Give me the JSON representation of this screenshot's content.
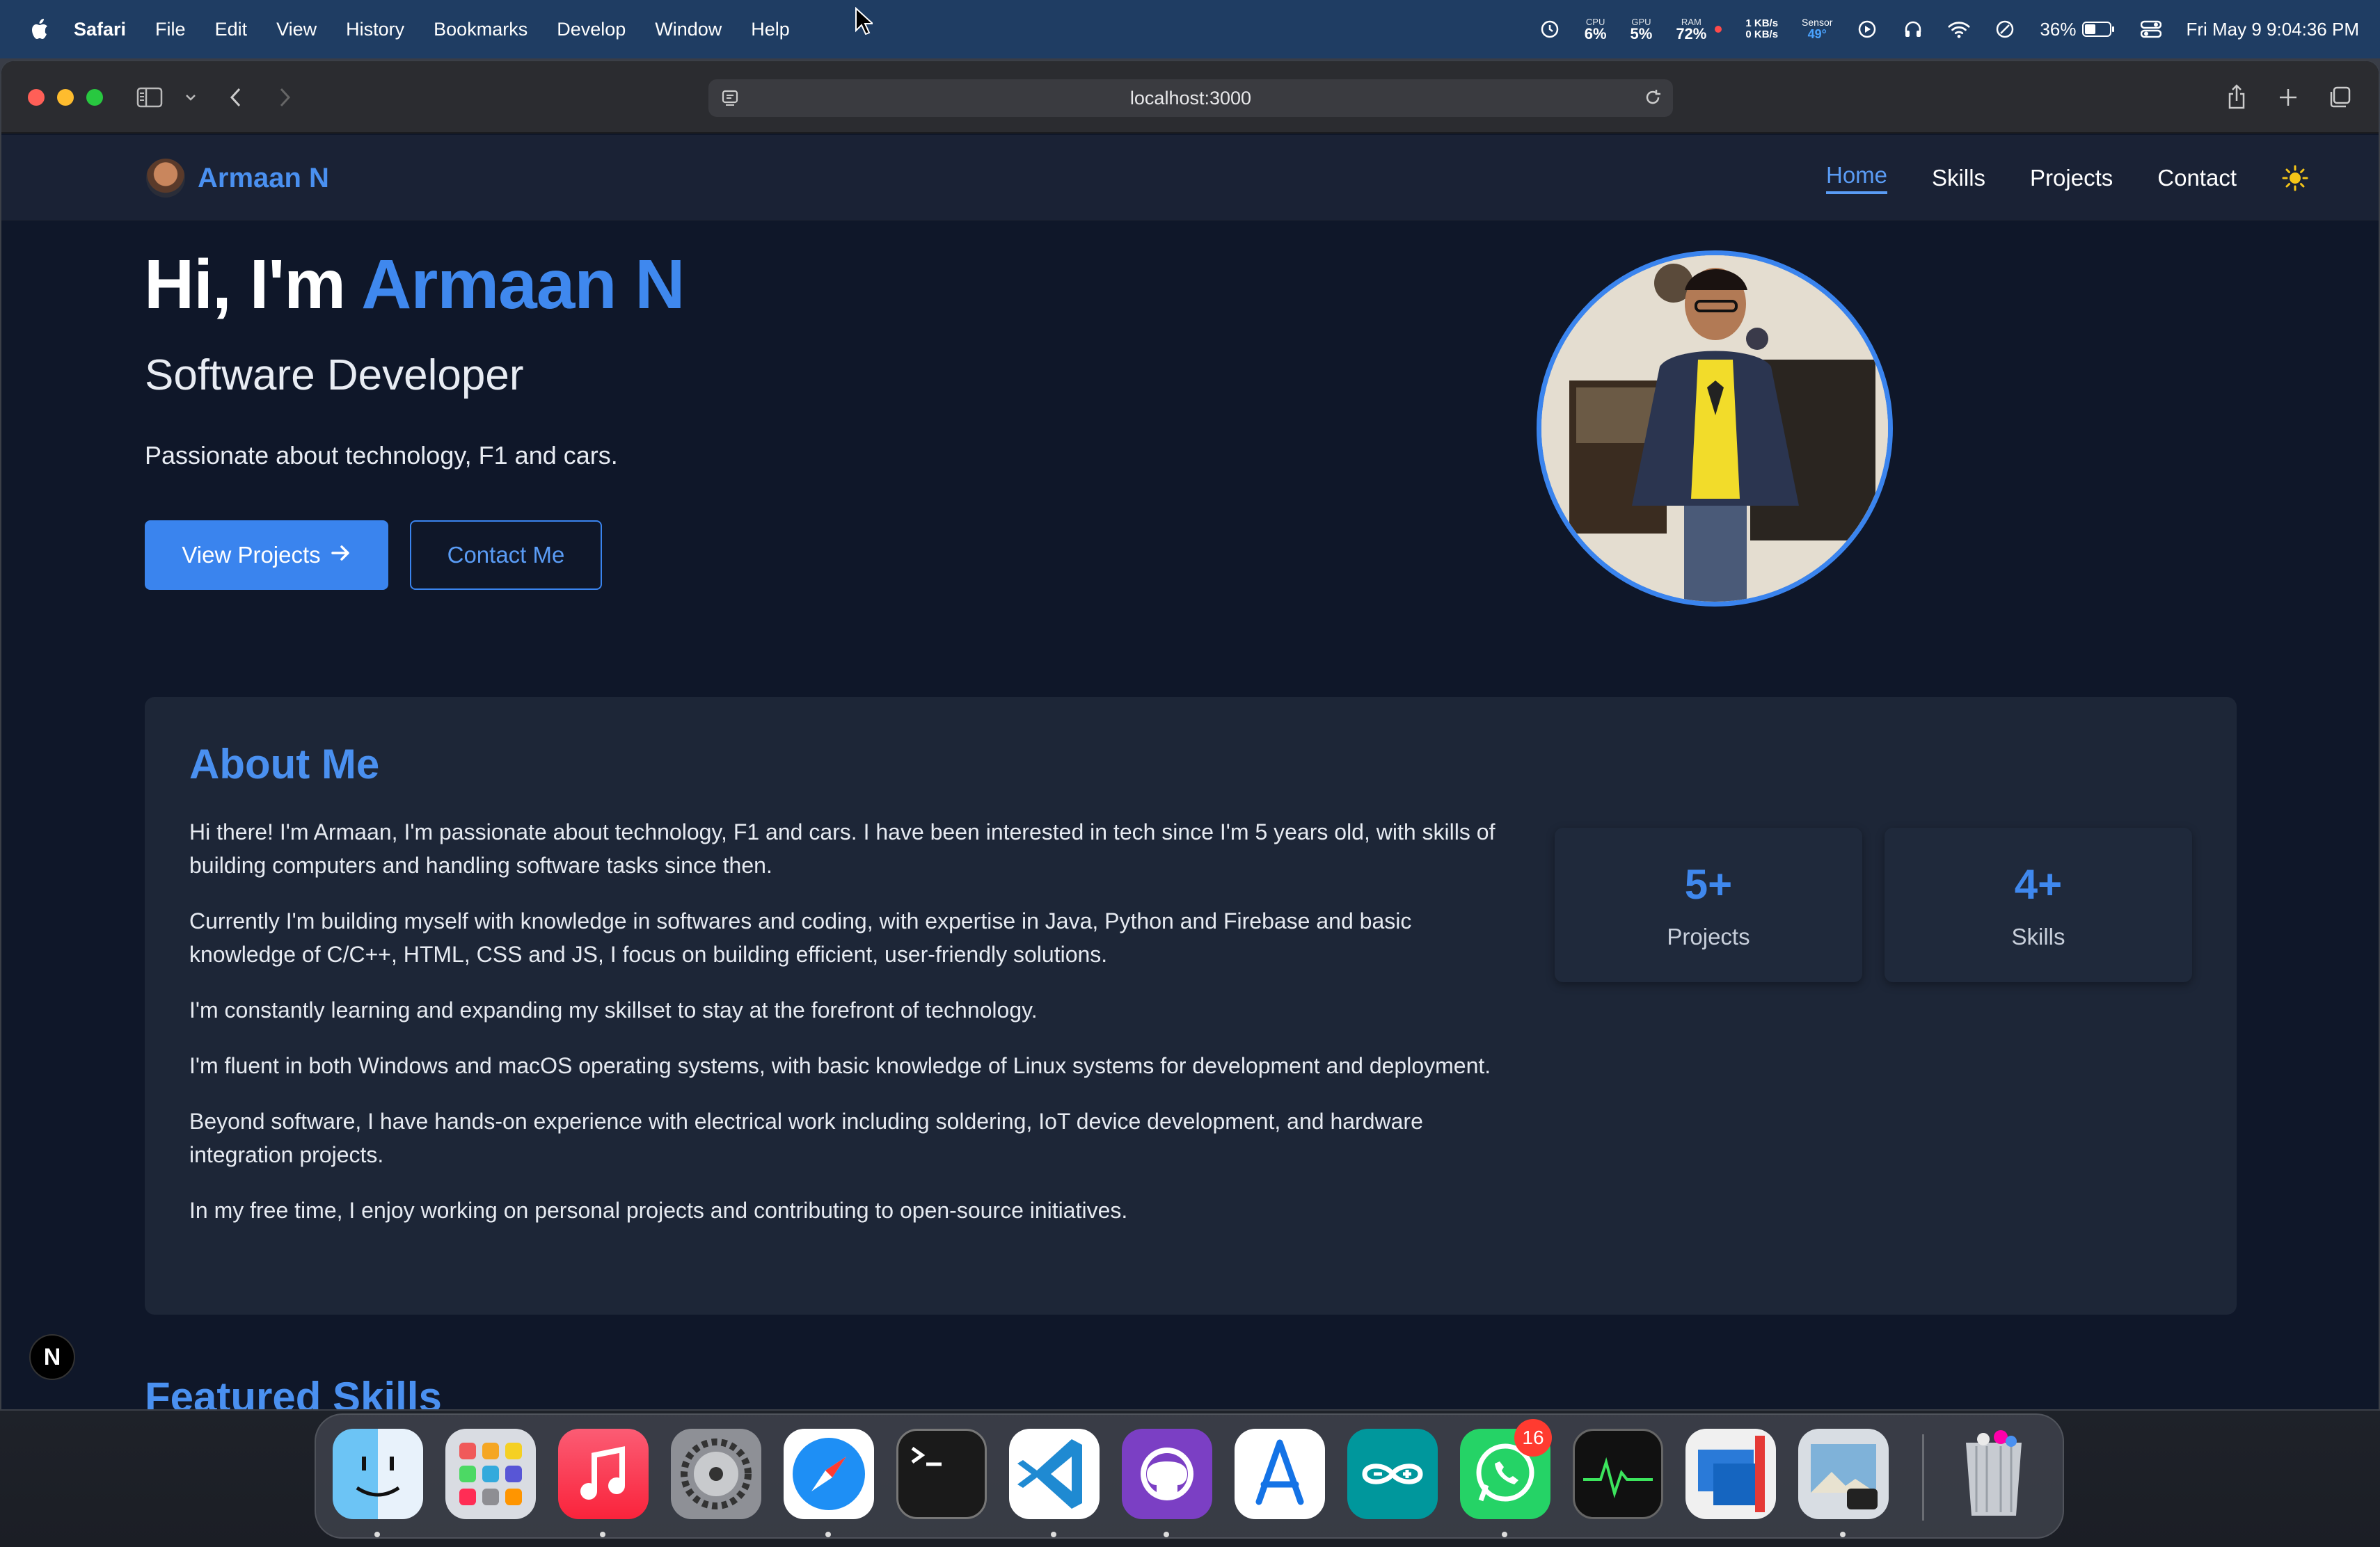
{
  "menubar": {
    "app": "Safari",
    "items": [
      "File",
      "Edit",
      "View",
      "History",
      "Bookmarks",
      "Develop",
      "Window",
      "Help"
    ],
    "cpu_label": "CPU",
    "cpu_value": "6%",
    "gpu_label": "GPU",
    "gpu_value": "5%",
    "ram_label": "RAM",
    "ram_value": "72%",
    "net_up": "1 KB/s",
    "net_down": "0 KB/s",
    "sensor_label": "Sensor",
    "sensor_value": "49°",
    "battery": "36%",
    "datetime": "Fri May 9  9:04:36 PM"
  },
  "browser": {
    "url": "localhost:3000"
  },
  "nav": {
    "brand": "Armaan N",
    "links": [
      "Home",
      "Skills",
      "Projects",
      "Contact"
    ],
    "active": "Home"
  },
  "hero": {
    "greeting": "Hi, I'm ",
    "name": "Armaan N",
    "subtitle": "Software Developer",
    "tagline": "Passionate about technology, F1 and cars.",
    "primary_button": "View Projects",
    "secondary_button": "Contact Me"
  },
  "about": {
    "title": "About Me",
    "paragraphs": [
      "Hi there! I'm Armaan, I'm passionate about technology, F1 and cars. I have been interested in tech since I'm 5 years old, with skills of building computers and handling software tasks since then.",
      "Currently I'm building myself with knowledge in softwares and coding, with expertise in Java, Python and Firebase and basic knowledge of C/C++, HTML, CSS and JS, I focus on building efficient, user-friendly solutions.",
      "I'm constantly learning and expanding my skillset to stay at the forefront of technology.",
      "I'm fluent in both Windows and macOS operating systems, with basic knowledge of Linux systems for development and deployment.",
      "Beyond software, I have hands-on experience with electrical work including soldering, IoT device development, and hardware integration projects.",
      "In my free time, I enjoy working on personal projects and contributing to open-source initiatives."
    ],
    "stats": [
      {
        "value": "5+",
        "label": "Projects"
      },
      {
        "value": "4+",
        "label": "Skills"
      }
    ]
  },
  "featured": {
    "title": "Featured Skills"
  },
  "nextjs_badge": "N",
  "dock": {
    "apps": [
      "Finder",
      "Launchpad",
      "Music",
      "System Settings",
      "Safari",
      "Terminal",
      "Visual Studio Code",
      "GitHub Desktop",
      "App Store",
      "Arduino IDE",
      "WhatsApp",
      "Activity Monitor",
      "Microsoft Remote Desktop",
      "Preview",
      "Trash"
    ],
    "whatsapp_badge": "16"
  },
  "colors": {
    "accent": "#3a84ee",
    "page_bg": "#0f1729",
    "card_bg": "#1d2637",
    "menubar_bg": "#1f3d63"
  }
}
